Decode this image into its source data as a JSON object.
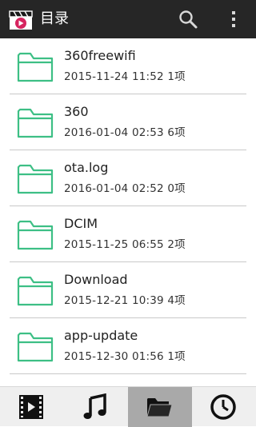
{
  "header": {
    "title": "目录",
    "app_icon": "clapperboard-play-icon",
    "search_icon": "search-icon",
    "menu_icon": "overflow-menu-icon"
  },
  "colors": {
    "appbar": "#262626",
    "folder_stroke": "#3dbf85",
    "active_tab": "#a9a9a9"
  },
  "folders": [
    {
      "name": "360freewifi",
      "meta": "2015-11-24 11:52  1项"
    },
    {
      "name": "360",
      "meta": "2016-01-04 02:53  6项"
    },
    {
      "name": "ota.log",
      "meta": "2016-01-04 02:52  0项"
    },
    {
      "name": "DCIM",
      "meta": "2015-11-25 06:55  2项"
    },
    {
      "name": "Download",
      "meta": "2015-12-21 10:39  4项"
    },
    {
      "name": "app-update",
      "meta": "2015-12-30 01:56  1项"
    }
  ],
  "tabs": [
    {
      "icon": "film-strip-icon",
      "active": false
    },
    {
      "icon": "music-note-icon",
      "active": false
    },
    {
      "icon": "folder-icon",
      "active": true
    },
    {
      "icon": "clock-icon",
      "active": false
    }
  ]
}
